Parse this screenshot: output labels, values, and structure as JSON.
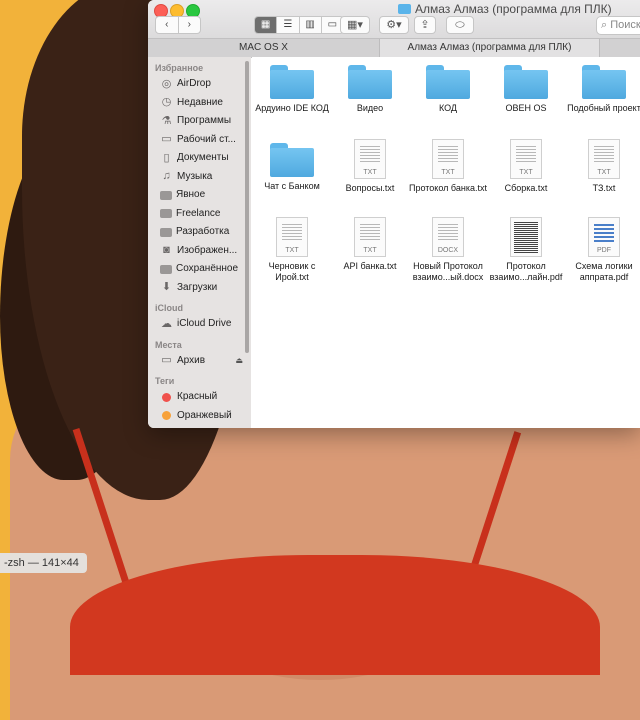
{
  "window": {
    "title": "Алмаз Алмаз (программа для ПЛК)",
    "search_placeholder": "Поиск"
  },
  "tabs": [
    {
      "label": "MAC OS X"
    },
    {
      "label": "Алмаз Алмаз (программа для ПЛК)"
    }
  ],
  "sidebar": {
    "favorites_header": "Избранное",
    "favorites": [
      {
        "label": "AirDrop",
        "icon": "airdrop-icon"
      },
      {
        "label": "Недавние",
        "icon": "clock-icon"
      },
      {
        "label": "Программы",
        "icon": "apps-icon"
      },
      {
        "label": "Рабочий ст...",
        "icon": "desktop-icon"
      },
      {
        "label": "Документы",
        "icon": "documents-icon"
      },
      {
        "label": "Музыка",
        "icon": "music-icon"
      },
      {
        "label": "Явное",
        "icon": "folder-icon"
      },
      {
        "label": "Freelance",
        "icon": "folder-icon"
      },
      {
        "label": "Разработка",
        "icon": "folder-icon"
      },
      {
        "label": "Изображен...",
        "icon": "camera-icon"
      },
      {
        "label": "Сохранённое",
        "icon": "folder-icon"
      },
      {
        "label": "Загрузки",
        "icon": "download-icon"
      }
    ],
    "icloud_header": "iCloud",
    "icloud": [
      {
        "label": "iCloud Drive",
        "icon": "cloud-icon"
      }
    ],
    "places_header": "Места",
    "places": [
      {
        "label": "Архив",
        "icon": "drive-icon"
      }
    ],
    "tags_header": "Теги",
    "tags": [
      {
        "label": "Красный",
        "color": "#f0514c"
      },
      {
        "label": "Оранжевый",
        "color": "#f7a13a"
      }
    ]
  },
  "files": [
    {
      "name": "Ардуино IDE КОД",
      "type": "folder"
    },
    {
      "name": "Видео",
      "type": "folder"
    },
    {
      "name": "КОД",
      "type": "folder"
    },
    {
      "name": "ОВЕН OS",
      "type": "folder"
    },
    {
      "name": "Подобный проект",
      "type": "folder"
    },
    {
      "name": "Чат с Банком",
      "type": "folder"
    },
    {
      "name": "Вопросы.txt",
      "type": "txt",
      "ext": "TXT"
    },
    {
      "name": "Протокол банка.txt",
      "type": "txt",
      "ext": "TXT"
    },
    {
      "name": "Сборка.txt",
      "type": "txt",
      "ext": "TXT"
    },
    {
      "name": "ТЗ.txt",
      "type": "txt",
      "ext": "TXT"
    },
    {
      "name": "Черновик с Ирой.txt",
      "type": "txt",
      "ext": "TXT"
    },
    {
      "name": "API банка.txt",
      "type": "txt",
      "ext": "TXT"
    },
    {
      "name": "Новый Протокол взаимо...ый.docx",
      "type": "docx",
      "ext": "DOCX"
    },
    {
      "name": "Протокол взаимо...лайн.pdf",
      "type": "pdf-dark",
      "ext": ""
    },
    {
      "name": "Схема логики аппрата.pdf",
      "type": "pdf",
      "ext": "PDF"
    }
  ],
  "terminal": {
    "title": "-zsh — 141×44"
  }
}
